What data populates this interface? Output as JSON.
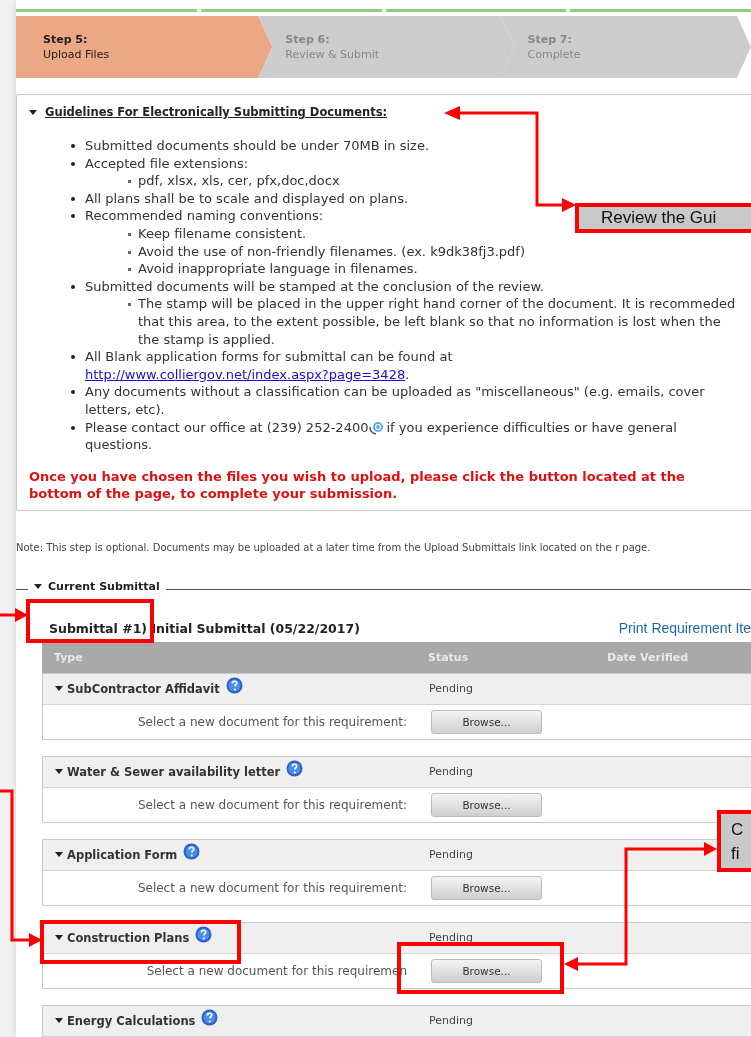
{
  "steps": [
    {
      "label": "Step 5:",
      "title": "Upload Files",
      "selected": true
    },
    {
      "label": "Step 6:",
      "title": "Review & Submit",
      "selected": false
    },
    {
      "label": "Step 7:",
      "title": "Complete",
      "selected": false
    }
  ],
  "guidelines": {
    "title": "Guidelines For Electronically Submitting Documents:",
    "expanded": true,
    "items": [
      {
        "kind": "plain",
        "text": "Submitted documents should be under 70MB in size."
      },
      {
        "kind": "plain",
        "text": "Accepted file extensions:",
        "children": [
          {
            "text": "pdf, xlsx, xls, cer, pfx,doc,docx"
          }
        ]
      },
      {
        "kind": "plain",
        "text": "All plans shall be to scale and displayed on plans."
      },
      {
        "kind": "plain",
        "text": "Recommended naming conventions:",
        "children": [
          {
            "text": "Keep filename consistent."
          },
          {
            "text": "Avoid the use of non-friendly filenames. (ex. k9dk38fj3.pdf)"
          },
          {
            "text": "Avoid inappropriate language in filenames."
          }
        ]
      },
      {
        "kind": "plain",
        "text": "Submitted documents will be stamped at the conclusion of the review.",
        "children": [
          {
            "text": "The stamp will be placed in the upper right hand corner of the document. It is recommeded that this area, to the extent possible, be left blank so that no information is lost when the the stamp is applied."
          }
        ]
      },
      {
        "kind": "link",
        "text": "All Blank application forms for submittal can be found at",
        "link": "http://www.colliergov.net/index.aspx?page=3428",
        "after": "."
      },
      {
        "kind": "plain",
        "text": "Any documents without a classification can be uploaded as \"miscellaneous\" (e.g. emails, cover letters, etc)."
      },
      {
        "kind": "phone",
        "text": "Please contact our office at (239) 252-2400",
        "after": [
          "if you experience difficulties or have general",
          "questions."
        ]
      }
    ],
    "warning": "Once you have chosen the files you wish to upload, please click the button located at the bottom of the page, to complete your submission."
  },
  "note": "Note: This step is optional. Documents may be uploaded at a later time from the Upload Submittals link located on the r page.",
  "current_submittal": {
    "legend": "Current Submittal",
    "expanded": true,
    "heading": "Submittal #1) Initial Submittal (05/22/2017)",
    "print_link": "Print Requirement Ite",
    "columns": [
      "Type",
      "Status",
      "Date Verified"
    ],
    "requirements": [
      {
        "name": "SubContractor Affidavit",
        "status": "Pending",
        "prompt": "Select a new document for this requirement:",
        "button": "Browse..."
      },
      {
        "name": "Water & Sewer availability letter",
        "status": "Pending",
        "prompt": "Select a new document for this requirement:",
        "button": "Browse..."
      },
      {
        "name": "Application Form",
        "status": "Pending",
        "prompt": "Select a new document for this requirement:",
        "button": "Browse..."
      },
      {
        "name": "Construction Plans",
        "status": "Pending",
        "prompt": "Select a new document for this requiremen",
        "button": "Browse..."
      },
      {
        "name": "Energy Calculations",
        "status": "Pending"
      }
    ]
  },
  "annotations": [
    {
      "kind": "callout",
      "lines": [
        "Review the Gui"
      ]
    },
    {
      "kind": "callout",
      "lines": [
        "C",
        "fi"
      ]
    }
  ]
}
